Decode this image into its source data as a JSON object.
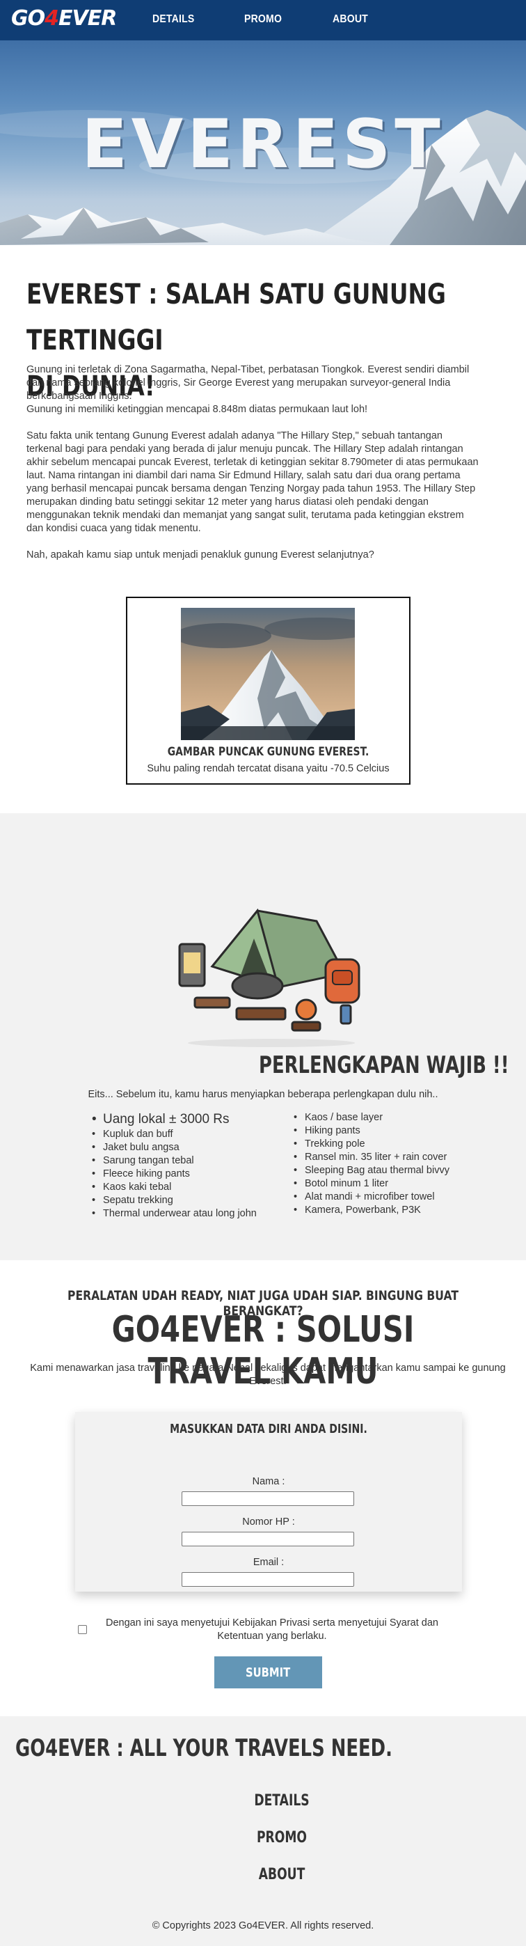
{
  "nav": {
    "logo_left": "GO",
    "logo_accent": "4",
    "logo_right": "EVER",
    "links": [
      "DETAILS",
      "PROMO",
      "ABOUT"
    ]
  },
  "hero": {
    "title": "EVEREST"
  },
  "intro": {
    "heading_line1": "EVEREST : SALAH SATU GUNUNG TERTINGGI",
    "heading_line2": "DI DUNIA!",
    "p1": "Gunung ini terletak di Zona Sagarmatha, Nepal-Tibet, perbatasan Tiongkok. Everest sendiri diambil dari nama seorang kolonel inggris, Sir George Everest yang merupakan surveyor-general India berkebangsaan Inggris.",
    "p2": "Gunung ini memiliki ketinggian mencapai 8.848m diatas permukaan laut loh!",
    "p3": "Satu fakta unik tentang Gunung Everest adalah adanya \"The Hillary Step,\" sebuah tantangan terkenal bagi para pendaki yang berada di jalur menuju puncak. The Hillary Step adalah rintangan akhir sebelum mencapai puncak Everest, terletak di ketinggian sekitar 8.790meter di atas permukaan laut. Nama rintangan ini diambil dari nama Sir Edmund Hillary, salah satu dari dua orang pertama yang berhasil mencapai puncak bersama dengan Tenzing Norgay pada tahun 1953. The Hillary Step merupakan dinding batu setinggi sekitar 12 meter yang harus diatasi oleh pendaki dengan menggunakan teknik mendaki dan memanjat yang sangat sulit, terutama pada ketinggian ekstrem dan kondisi cuaca yang tidak menentu.",
    "p4": "Nah, apakah kamu siap untuk menjadi penakluk gunung Everest selanjutnya?"
  },
  "figure": {
    "caption": "GAMBAR PUNCAK GUNUNG EVEREST.",
    "sub": "Suhu paling rendah tercatat disana yaitu -70.5 Celcius"
  },
  "gear": {
    "heading": "PERLENGKAPAN WAJIB !!",
    "sub": "Eits... Sebelum itu, kamu harus menyiapkan beberapa perlengkapan dulu nih..",
    "left": [
      "Uang lokal ± 3000 Rs",
      "Kupluk dan buff",
      "Jaket bulu angsa",
      "Sarung tangan tebal",
      "Fleece hiking pants",
      "Kaos kaki tebal",
      "Sepatu trekking",
      "Thermal underwear atau long john"
    ],
    "right": [
      "Kaos / base layer",
      "Hiking pants",
      "Trekking pole",
      "Ransel min. 35 liter + rain cover",
      "Sleeping Bag atau thermal bivvy",
      "Botol minum 1 liter",
      "Alat mandi + microfiber towel",
      "Kamera, Powerbank, P3K"
    ]
  },
  "booking": {
    "sub": "PERALATAN UDAH READY, NIAT JUGA UDAH SIAP. BINGUNG BUAT BERANGKAT?",
    "title": "GO4EVER : SOLUSI TRAVEL KAMU",
    "desc": "Kami menawarkan jasa traveling ke negara Nepal sekaligus dapat mengantarkan kamu sampai ke gunung Everest.",
    "form_title": "MASUKKAN DATA DIRI ANDA DISINI.",
    "name_label": "Nama :",
    "name_value": "",
    "phone_label": "Nomor HP :",
    "phone_value": "",
    "email_label": "Email :",
    "email_value": "",
    "consent": "Dengan ini saya menyetujui Kebijakan Privasi serta menyetujui Syarat dan Ketentuan yang berlaku.",
    "submit": "SUBMIT"
  },
  "footer": {
    "title": "GO4EVER : ALL YOUR TRAVELS NEED.",
    "links": [
      "DETAILS",
      "PROMO",
      "ABOUT"
    ],
    "copyright": "© Copyrights 2023 Go4EVER. All rights reserved."
  },
  "colors": {
    "nav_bg": "#0f3d74",
    "logo_accent": "#e32424",
    "section_bg": "#f2f2f2",
    "submit_bg": "#6396b6"
  }
}
